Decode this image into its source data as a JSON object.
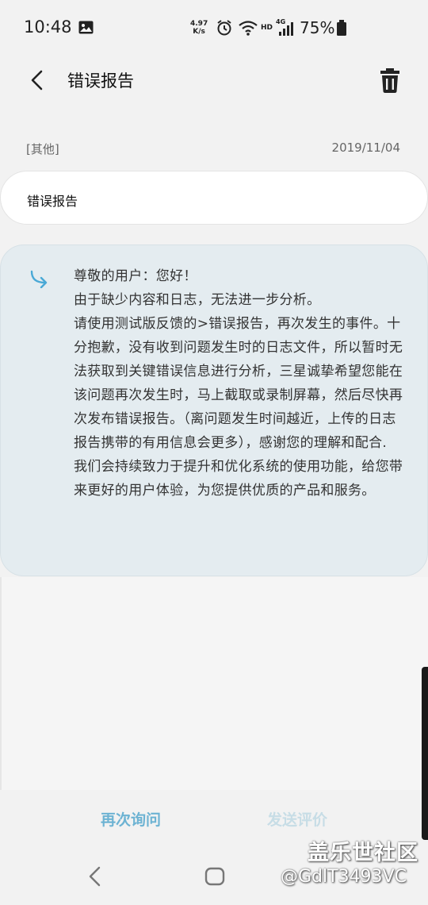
{
  "status_bar": {
    "time": "10:48",
    "net_speed_value": "4.97",
    "net_speed_unit": "K/s",
    "battery_percent": "75%",
    "icons": [
      "gallery-icon",
      "alarm-icon",
      "wifi-icon",
      "hd-icon",
      "signal-4g-icon",
      "battery-icon"
    ],
    "hd_label": "HD",
    "network_label": "4G"
  },
  "header": {
    "title": "错误报告",
    "back_icon": "chevron-left-icon",
    "delete_icon": "trash-icon"
  },
  "meta": {
    "category": "[其他]",
    "date": "2019/11/04"
  },
  "report": {
    "text": "错误报告"
  },
  "reply": {
    "icon": "reply-arrow-icon",
    "lines": [
      "尊敬的用户：您好！",
      "由于缺少内容和日志，无法进一步分析。",
      "请使用测试版反馈的>错误报告，再次发生的事件。十分抱歉，没有收到问题发生时的日志文件，所以暂时无法获取到关键错误信息进行分析，三星诚挚希望您能在该问题再次发生时，马上截取或录制屏幕，然后尽快再次发布错误报告。（离问题发生时间越近，上传的日志报告携带的有用信息会更多），感谢您的理解和配合.",
      "我们会持续致力于提升和优化系统的使用功能，给您带来更好的用户体验，为您提供优质的产品和服务。"
    ]
  },
  "actions": {
    "ask_again": "再次询问",
    "send_rating": "发送评价"
  },
  "watermark": {
    "title": "盖乐世社区",
    "user": "@GdlT3493VC"
  },
  "nav": {
    "back_icon": "nav-back-icon",
    "home_icon": "nav-home-icon"
  },
  "colors": {
    "background": "#f2f2f2",
    "reply_bubble": "#e4ecf0",
    "accent": "#6db3d3",
    "accent_disabled": "#c7dde6"
  }
}
